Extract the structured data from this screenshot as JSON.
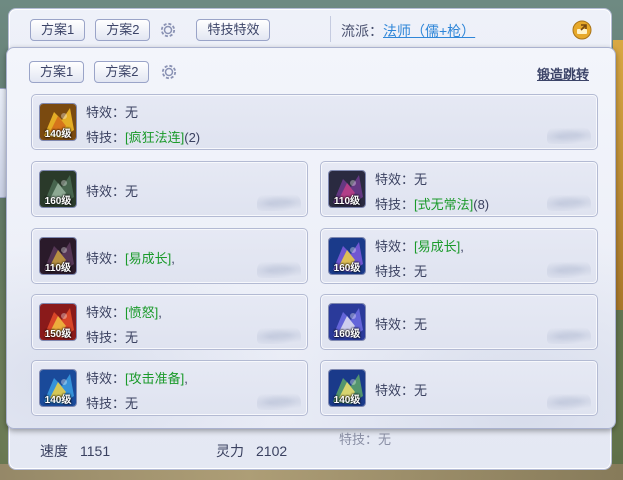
{
  "back_panel": {
    "plan_tabs": [
      "方案1",
      "方案2"
    ],
    "skill_effect_button": "特技特效",
    "genre_label": "流派：",
    "genre_value": "法师（儒+枪）",
    "stats": {
      "speed_label": "速度",
      "speed_value": "1151",
      "spirit_label": "灵力",
      "spirit_value": "2102"
    },
    "faded_text": "特技：无"
  },
  "front_panel": {
    "plan_tabs": [
      "方案1",
      "方案2"
    ],
    "forge_link": "锻造跳转",
    "items": [
      {
        "level": "140级",
        "lines": [
          {
            "label": "特效：",
            "value": "无",
            "suffix": ""
          },
          {
            "label": "特技：",
            "value": "[疯狂法连]",
            "suffix": "(2)"
          }
        ],
        "colors": [
          "#7a4a10",
          "#f0b828",
          "#d46a1a"
        ]
      },
      {
        "level": "160级",
        "lines": [
          {
            "label": "特效：",
            "value": "无",
            "suffix": ""
          }
        ],
        "colors": [
          "#2a3a2a",
          "#4a6a52",
          "#9ab5a0"
        ]
      },
      {
        "level": "110级",
        "lines": [
          {
            "label": "特效：",
            "value": "无",
            "suffix": ""
          },
          {
            "label": "特技：",
            "value": "[式无常法]",
            "suffix": "(8)"
          }
        ],
        "colors": [
          "#2a2a40",
          "#6a3a8a",
          "#c0408a"
        ]
      },
      {
        "level": "110级",
        "lines": [
          {
            "label": "特效：",
            "value": "[易成长]",
            "suffix": ","
          }
        ],
        "colors": [
          "#2a1a2a",
          "#5a3a5a",
          "#c9a040"
        ]
      },
      {
        "level": "160级",
        "lines": [
          {
            "label": "特效：",
            "value": "[易成长]",
            "suffix": ","
          },
          {
            "label": "特技：",
            "value": "无",
            "suffix": ""
          }
        ],
        "colors": [
          "#1a3a8a",
          "#7a5ad8",
          "#f0d040"
        ]
      },
      {
        "level": "150级",
        "lines": [
          {
            "label": "特效：",
            "value": "[愤怒]",
            "suffix": ","
          },
          {
            "label": "特技：",
            "value": "无",
            "suffix": ""
          }
        ],
        "colors": [
          "#8a1a1a",
          "#e04a2a",
          "#f0c040"
        ]
      },
      {
        "level": "160级",
        "lines": [
          {
            "label": "特效：",
            "value": "无",
            "suffix": ""
          }
        ],
        "colors": [
          "#2a3a9a",
          "#6a6ae0",
          "#e0e0f0"
        ]
      },
      {
        "level": "140级",
        "lines": [
          {
            "label": "特效：",
            "value": "[攻击准备]",
            "suffix": ","
          },
          {
            "label": "特技：",
            "value": "无",
            "suffix": ""
          }
        ],
        "colors": [
          "#1a4a9a",
          "#3a9ae0",
          "#f0d040"
        ]
      },
      {
        "level": "140级",
        "lines": [
          {
            "label": "特效：",
            "value": "无",
            "suffix": ""
          }
        ],
        "colors": [
          "#1a3a8a",
          "#5aa06a",
          "#f0e070"
        ]
      }
    ]
  }
}
